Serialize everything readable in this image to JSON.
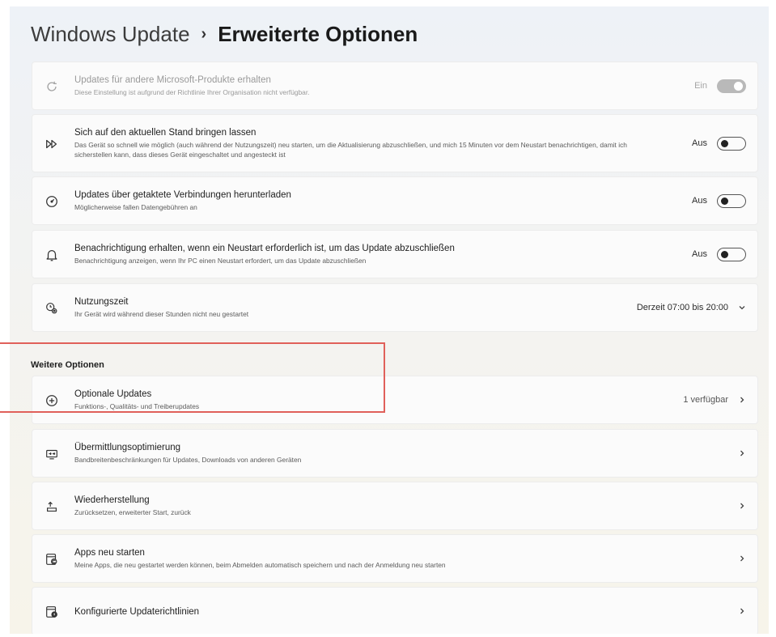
{
  "header": {
    "crumb": "Windows Update",
    "separator": "›",
    "current": "Erweiterte Optionen"
  },
  "settings": [
    {
      "title": "Updates für andere Microsoft-Produkte erhalten",
      "desc": "Diese Einstellung ist aufgrund der Richtlinie Ihrer Organisation nicht verfügbar.",
      "state": "Ein",
      "icon": "refresh-icon"
    },
    {
      "title": "Sich auf den aktuellen Stand bringen lassen",
      "desc": "Das Gerät so schnell wie möglich (auch während der Nutzungszeit) neu starten, um die Aktualisierung abzuschließen, und mich 15 Minuten vor dem Neustart benachrichtigen, damit ich sicherstellen kann, dass dieses Gerät eingeschaltet und angesteckt ist",
      "state": "Aus",
      "icon": "fast-forward-icon"
    },
    {
      "title": "Updates über getaktete Verbindungen herunterladen",
      "desc": "Möglicherweise fallen Datengebühren an",
      "state": "Aus",
      "icon": "gauge-icon"
    },
    {
      "title": "Benachrichtigung erhalten, wenn ein Neustart erforderlich ist, um das Update abzuschließen",
      "desc": "Benachrichtigung anzeigen, wenn Ihr PC einen Neustart erfordert, um das Update abzuschließen",
      "state": "Aus",
      "icon": "bell-icon"
    },
    {
      "title": "Nutzungszeit",
      "desc": "Ihr Gerät wird während dieser Stunden nicht neu gestartet",
      "value": "Derzeit 07:00 bis 20:00",
      "icon": "clock-gear-icon"
    }
  ],
  "more": {
    "label": "Weitere Optionen",
    "items": [
      {
        "title": "Optionale Updates",
        "desc": "Funktions-, Qualitäts- und Treiberupdates",
        "value": "1 verfügbar",
        "icon": "plus-circle-icon"
      },
      {
        "title": "Übermittlungsoptimierung",
        "desc": "Bandbreitenbeschränkungen für Updates, Downloads von anderen Geräten",
        "icon": "delivery-icon"
      },
      {
        "title": "Wiederherstellung",
        "desc": "Zurücksetzen, erweiterter Start, zurück",
        "icon": "recovery-icon"
      },
      {
        "title": "Apps neu starten",
        "desc": "Meine Apps, die neu gestartet werden können, beim Abmelden automatisch speichern und nach der Anmeldung neu starten",
        "icon": "app-restart-icon"
      },
      {
        "title": "Konfigurierte Updaterichtlinien",
        "icon": "policy-icon"
      }
    ]
  },
  "colors": {
    "highlight": "#e0605a",
    "card_bg": "#fbfbfb"
  }
}
